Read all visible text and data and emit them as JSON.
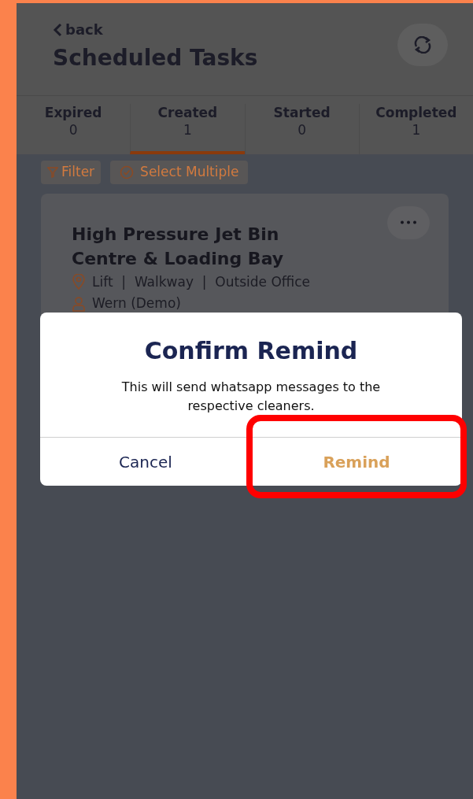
{
  "header": {
    "back_label": "back",
    "title": "Scheduled Tasks"
  },
  "tabs": [
    {
      "label": "Expired",
      "count": "0",
      "selected": false
    },
    {
      "label": "Created",
      "count": "1",
      "selected": true
    },
    {
      "label": "Started",
      "count": "0",
      "selected": false
    },
    {
      "label": "Completed",
      "count": "1",
      "selected": false
    }
  ],
  "toolbar": {
    "filter": "Filter",
    "select_multiple": "Select Multiple"
  },
  "task_card": {
    "title": "High Pressure Jet Bin Centre & Loading Bay",
    "location": "Lift  |  Walkway  |  Outside Office",
    "assignee": "Wern (Demo)"
  },
  "dialog": {
    "title": "Confirm Remind",
    "message": "This will send whatsapp messages to the respective cleaners.",
    "buttons": [
      {
        "label": "Cancel",
        "kind": "cancel"
      },
      {
        "label": "Remind",
        "kind": "confirm"
      }
    ],
    "highlight_frame": true
  }
}
